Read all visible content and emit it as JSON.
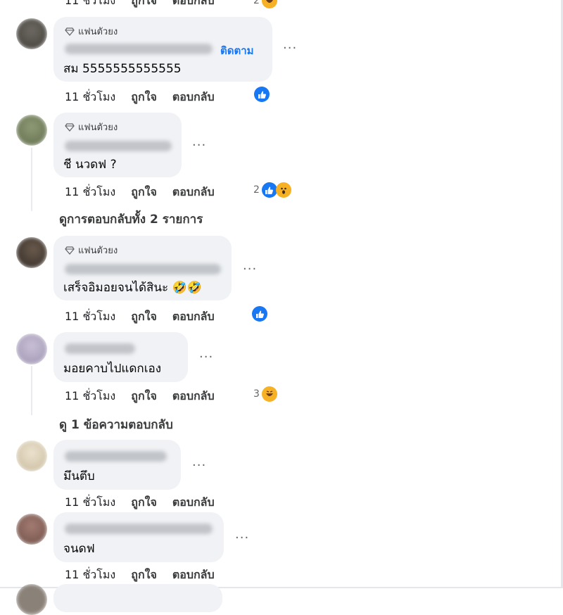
{
  "actions": {
    "time": "11 ชั่วโมง",
    "like": "ถูกใจ",
    "reply": "ตอบกลับ"
  },
  "top": {
    "reaction_count": "2"
  },
  "comments": [
    {
      "badge": "แฟนตัวยง",
      "follow": "ติดตาม",
      "text": "สม 5555555555555",
      "reaction_count": "",
      "reactions": [
        "like"
      ]
    },
    {
      "badge": "แฟนตัวยง",
      "text": "ชี นวดฟ ?",
      "reaction_count": "2",
      "reactions": [
        "like",
        "wow"
      ]
    },
    {
      "badge": "แฟนตัวยง",
      "text": "เสร็จอิมอยจนได้สินะ 🤣🤣",
      "reaction_count": "",
      "reactions": [
        "like"
      ]
    },
    {
      "text": "มอยคาบไปแดกเอง",
      "reaction_count": "3",
      "reactions": [
        "haha"
      ]
    },
    {
      "text": "มึนตึบ"
    },
    {
      "text": "จนดฟ"
    }
  ],
  "view_replies": [
    "ดูการตอบกลับทั้ง 2 รายการ",
    "ดู 1 ข้อความตอบกลับ"
  ],
  "colors": {
    "accent": "#1877f2",
    "bubble": "#f0f2f5",
    "haha": "#f7b125"
  }
}
